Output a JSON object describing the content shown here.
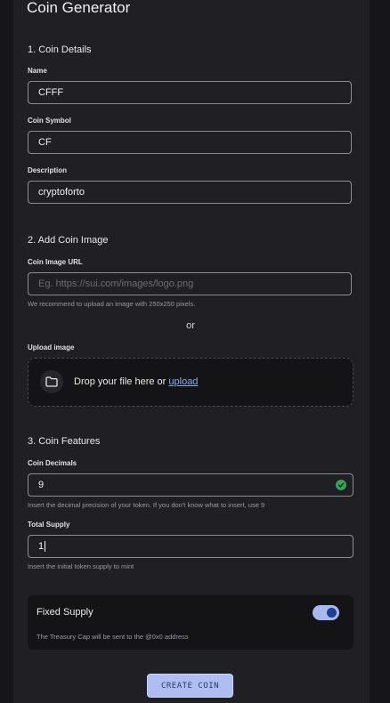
{
  "page": {
    "title": "Coin Generator"
  },
  "details": {
    "heading": "1. Coin Details",
    "name": {
      "label": "Name",
      "value": "CFFF"
    },
    "symbol": {
      "label": "Coin Symbol",
      "value": "CF"
    },
    "description": {
      "label": "Description",
      "value": "cryptoforto"
    }
  },
  "image": {
    "heading": "2. Add Coin Image",
    "url_label": "Coin Image URL",
    "url_placeholder": "Eg. https://sui.com/images/logo.png",
    "url_help": "We recommend to upload an image with 250x250 pixels.",
    "or": "or",
    "upload_label": "Upload image",
    "drop_text": "Drop your file here or",
    "upload_link": "upload",
    "folder_icon": "folder-icon"
  },
  "features": {
    "heading": "3. Coin Features",
    "decimals": {
      "label": "Coin Decimals",
      "value": "9",
      "help": "Insert the decimal precision of your token. If you don't know what to insert, use 9",
      "check_icon": "check-icon"
    },
    "supply": {
      "label": "Total Supply",
      "value": "1",
      "help": "Insert the initial token supply to mint"
    },
    "fixed": {
      "title": "Fixed Supply",
      "help": "The Treasury Cap will be sent to the @0x0 address",
      "enabled": true
    }
  },
  "actions": {
    "create": "CREATE COIN"
  },
  "colors": {
    "accent": "#aebef3",
    "success": "#30a657",
    "background": "#1f1f24"
  }
}
